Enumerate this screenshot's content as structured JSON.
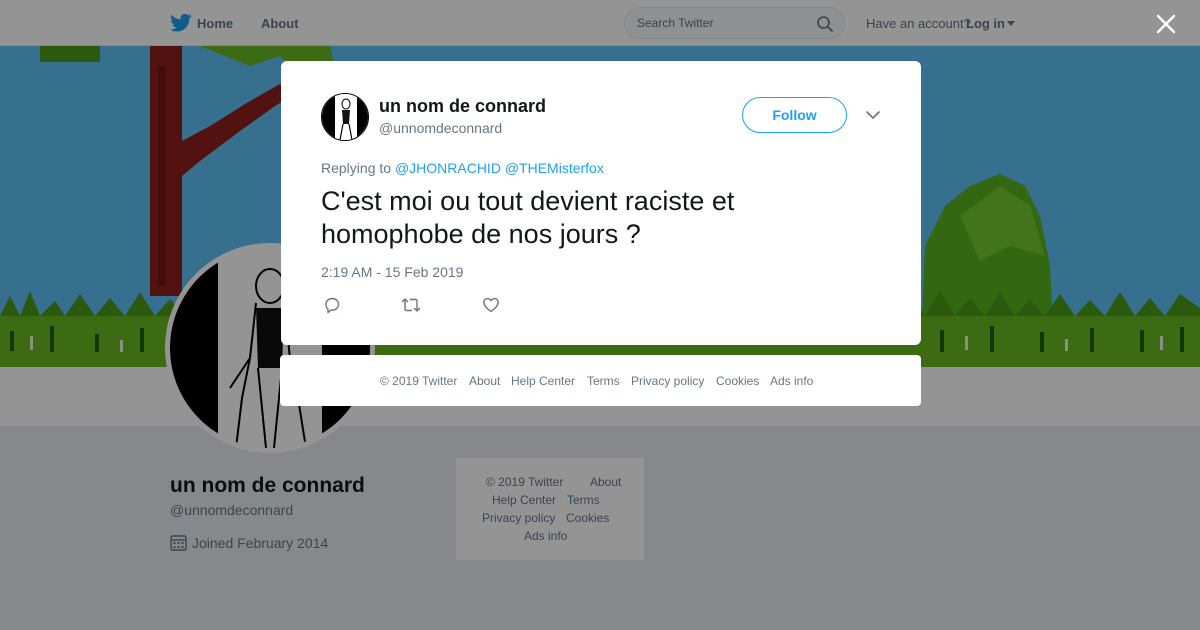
{
  "nav": {
    "home": "Home",
    "about": "About",
    "search_placeholder": "Search Twitter",
    "account_question": "Have an account?",
    "login": "Log in"
  },
  "profile": {
    "name": "un nom de connard",
    "handle": "@unnomdeconnard",
    "joined": "Joined February 2014"
  },
  "side_footer": {
    "copyright": "© 2019 Twitter",
    "about": "About",
    "help": "Help Center",
    "terms": "Terms",
    "privacy": "Privacy policy",
    "cookies": "Cookies",
    "ads": "Ads info"
  },
  "tweet": {
    "name": "un nom de connard",
    "handle": "@unnomdeconnard",
    "follow": "Follow",
    "replying_prefix": "Replying to",
    "mentions": [
      "@JHONRACHID",
      "@THEMisterfox"
    ],
    "text": "C'est moi ou tout devient raciste et homophobe de nos jours ?",
    "timestamp": "2:19 AM - 15 Feb 2019"
  },
  "modal_footer": {
    "copyright": "© 2019 Twitter",
    "about": "About",
    "help": "Help Center",
    "terms": "Terms",
    "privacy": "Privacy policy",
    "cookies": "Cookies",
    "ads": "Ads info"
  },
  "icons": {
    "logo": "twitter-bird-icon",
    "search": "search-icon",
    "close": "close-icon",
    "more": "chevron-down-icon",
    "reply": "reply-icon",
    "retweet": "retweet-icon",
    "like": "heart-icon",
    "calendar": "calendar-icon"
  },
  "colors": {
    "brand": "#1da1f2",
    "text": "#14171a",
    "secondary": "#657786",
    "banner_sky": "#5fbff5"
  }
}
